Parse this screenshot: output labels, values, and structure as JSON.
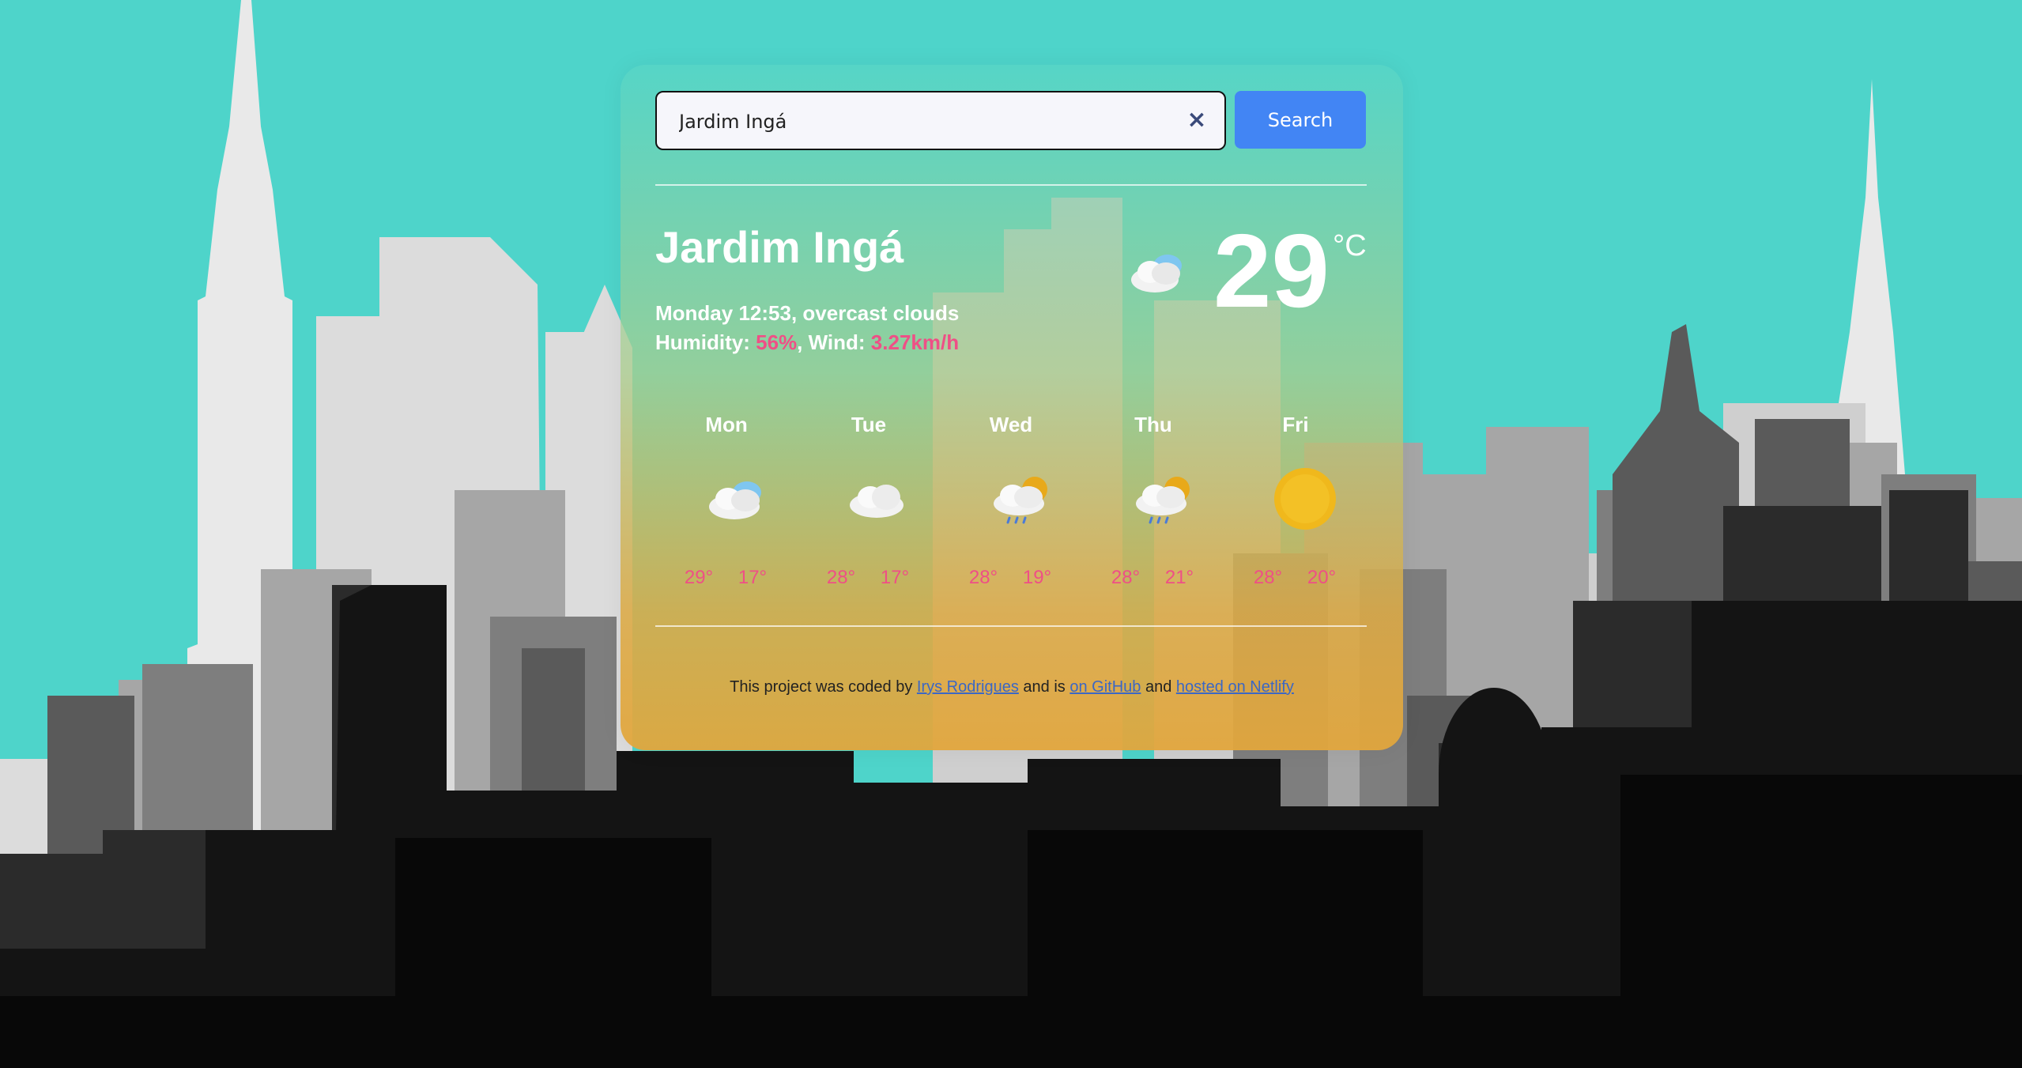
{
  "search": {
    "value": "Jardim Ingá",
    "button_label": "Search"
  },
  "current": {
    "city": "Jardim Ingá",
    "datetime_desc": "Monday 12:53, overcast clouds",
    "humidity_label": "Humidity: ",
    "humidity": "56%",
    "wind_label": ", Wind: ",
    "wind": "3.27km/h",
    "temperature": "29",
    "unit": "°C",
    "icon": "overcast-clouds-icon"
  },
  "forecast": [
    {
      "day": "Mon",
      "max": "29°",
      "min": "17°",
      "icon": "overcast-clouds-icon"
    },
    {
      "day": "Tue",
      "max": "28°",
      "min": "17°",
      "icon": "cloud-icon"
    },
    {
      "day": "Wed",
      "max": "28°",
      "min": "19°",
      "icon": "sun-rain-icon"
    },
    {
      "day": "Thu",
      "max": "28°",
      "min": "21°",
      "icon": "sun-rain-icon"
    },
    {
      "day": "Fri",
      "max": "28°",
      "min": "20°",
      "icon": "sun-icon"
    }
  ],
  "footer": {
    "prefix": "This project was coded by ",
    "author": "Irys Rodrigues",
    "middle": " and is ",
    "github": "on GitHub",
    "and": " and ",
    "netlify": "hosted on Netlify"
  },
  "colors": {
    "background": "#4ed4ca",
    "accent": "#ef4f86",
    "button": "#4285f4"
  }
}
